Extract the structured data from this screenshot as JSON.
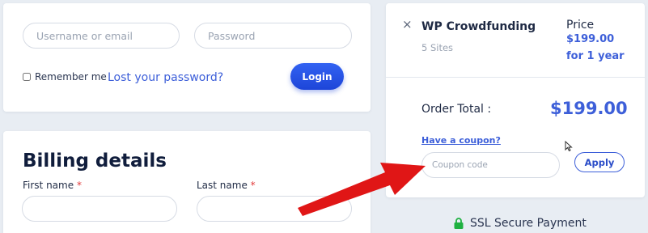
{
  "login": {
    "username_placeholder": "Username or email",
    "password_placeholder": "Password",
    "remember_label": "Remember me",
    "lost_password_label": "Lost your password?",
    "login_button_label": "Login"
  },
  "billing": {
    "title": "Billing details",
    "first_name_label": "First name",
    "last_name_label": "Last name",
    "required_marker": "*"
  },
  "order": {
    "remove_icon": "×",
    "product_name": "WP Crowdfunding",
    "product_sites": "5 Sites",
    "price_label": "Price",
    "price_value": "$199.00",
    "price_period": "for 1 year",
    "total_label": "Order Total :",
    "total_value": "$199.00",
    "coupon_link_label": "Have a coupon?",
    "coupon_placeholder": "Coupon code",
    "apply_button_label": "Apply"
  },
  "ssl": {
    "label": "SSL Secure Payment",
    "icon": "lock-icon"
  },
  "colors": {
    "accent": "#3d5fd9",
    "login_button": "#1d45d8",
    "page_background": "#e8edf3",
    "required": "#e23a3a",
    "ssl_lock": "#1fb141",
    "annotation_arrow": "#e01616"
  }
}
